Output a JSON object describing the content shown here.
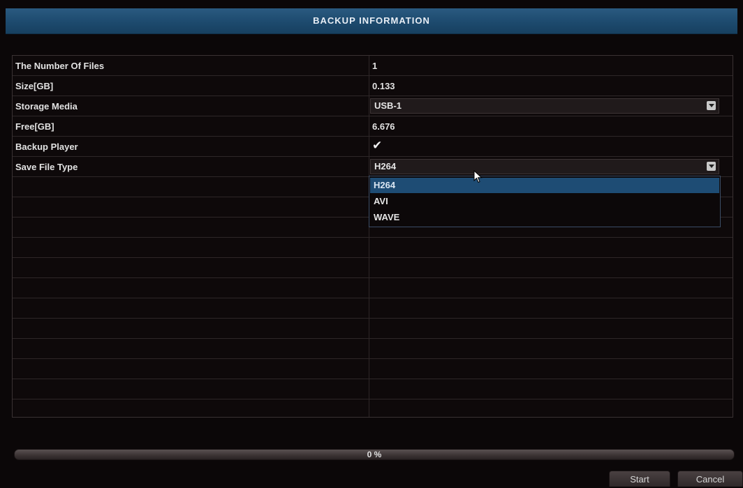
{
  "window": {
    "title": "BACKUP INFORMATION"
  },
  "fields": {
    "number_of_files": {
      "label": "The Number Of Files",
      "value": "1"
    },
    "size": {
      "label": "Size[GB]",
      "value": "0.133"
    },
    "storage_media": {
      "label": "Storage Media",
      "value": "USB-1"
    },
    "free": {
      "label": "Free[GB]",
      "value": "6.676"
    },
    "backup_player": {
      "label": "Backup Player",
      "checked": true
    },
    "save_file_type": {
      "label": "Save File Type",
      "value": "H264"
    }
  },
  "dropdown": {
    "options": [
      "H264",
      "AVI",
      "WAVE"
    ],
    "highlighted": "H264"
  },
  "progress": {
    "percent": 0,
    "text": "0 %"
  },
  "buttons": {
    "start": "Start",
    "cancel": "Cancel"
  },
  "colors": {
    "title_bar": "#1d4a6e",
    "highlight": "#1e4c74",
    "background": "#0b0708"
  },
  "icons": {
    "checkmark": "check-icon",
    "dropdown_arrow": "chevron-down-icon",
    "pointer": "mouse-cursor-icon"
  }
}
